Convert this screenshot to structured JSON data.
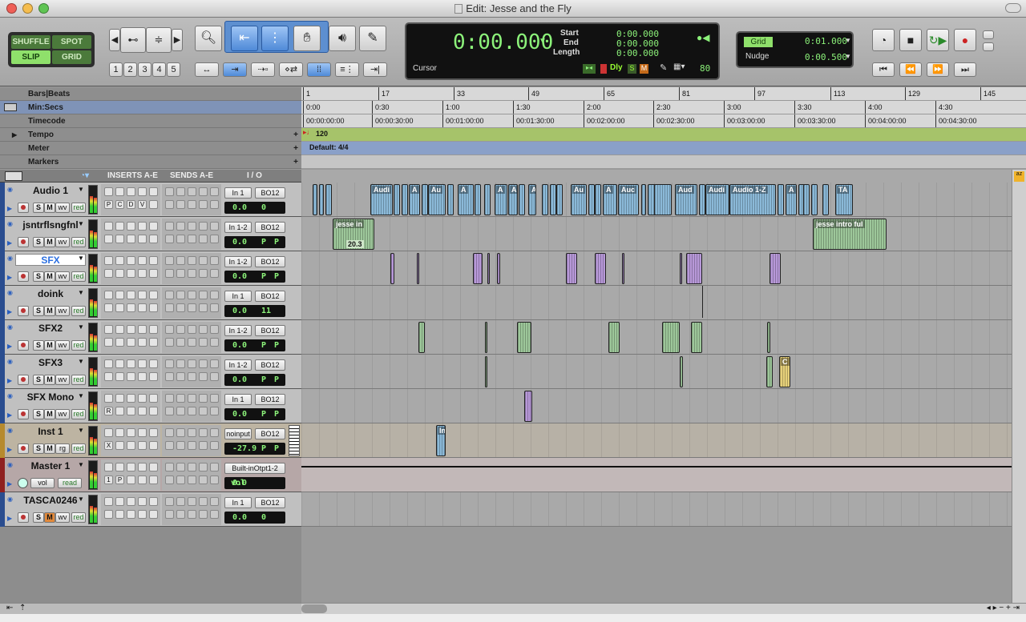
{
  "window": {
    "title": "Edit: Jesse and the Fly"
  },
  "modes": {
    "shuffle": "SHUFFLE",
    "spot": "SPOT",
    "slip": "SLIP",
    "grid": "GRID"
  },
  "zoom_presets": [
    "1",
    "2",
    "3",
    "4",
    "5"
  ],
  "counter": {
    "main": "0:00.000",
    "start_label": "Start",
    "start": "0:00.000",
    "end_label": "End",
    "end": "0:00.000",
    "length_label": "Length",
    "length": "0:00.000",
    "cursor_label": "Cursor",
    "dly": "Dly",
    "s": "S",
    "m": "M",
    "tempo_num": "80"
  },
  "grid": {
    "label": "Grid",
    "value": "0:01.000",
    "nudge_label": "Nudge",
    "nudge_value": "0:00.500"
  },
  "rulers": {
    "bars_label": "Bars|Beats",
    "bars_ticks": [
      "1",
      "17",
      "33",
      "49",
      "65",
      "81",
      "97",
      "113",
      "129",
      "145"
    ],
    "minsecs_label": "Min:Secs",
    "minsecs_ticks": [
      "0:00",
      "0:30",
      "1:00",
      "1:30",
      "2:00",
      "2:30",
      "3:00",
      "3:30",
      "4:00",
      "4:30"
    ],
    "timecode_label": "Timecode",
    "timecode_ticks": [
      "00:00:00:00",
      "00:00:30:00",
      "00:01:00:00",
      "00:01:30:00",
      "00:02:00:00",
      "00:02:30:00",
      "00:03:00:00",
      "00:03:30:00",
      "00:04:00:00",
      "00:04:30:00"
    ],
    "tempo_label": "Tempo",
    "tempo_value": "120",
    "meter_label": "Meter",
    "meter_value": "Default: 4/4",
    "markers_label": "Markers"
  },
  "columns": {
    "inserts": "INSERTS A-E",
    "sends": "SENDS A-E",
    "io": "I / O"
  },
  "tracks": [
    {
      "name": "Audio 1",
      "input": "In 1",
      "output": "BO12",
      "vol": "0.0",
      "pan": "0",
      "mode": "wv",
      "auto": "red",
      "slots": [
        "P",
        "C",
        "D",
        "V"
      ],
      "color": "#2a4d8f"
    },
    {
      "name": "jsntrflsngfnl",
      "input": "In 1-2",
      "output": "BO12",
      "vol": "0.0",
      "pan": "P",
      "pan2": "P",
      "mode": "wv",
      "auto": "red",
      "slots": [],
      "color": "#2a4d8f"
    },
    {
      "name": "SFX",
      "input": "In 1-2",
      "output": "BO12",
      "vol": "0.0",
      "pan": "P",
      "pan2": "P",
      "mode": "wv",
      "auto": "red",
      "slots": [],
      "color": "#2a4d8f"
    },
    {
      "name": "doink",
      "input": "In 1",
      "output": "BO12",
      "vol": "0.0",
      "pan": "11",
      "mode": "wv",
      "auto": "red",
      "slots": [],
      "color": "#2a4d8f"
    },
    {
      "name": "SFX2",
      "input": "In 1-2",
      "output": "BO12",
      "vol": "0.0",
      "pan": "P",
      "pan2": "P",
      "mode": "wv",
      "auto": "red",
      "slots": [],
      "color": "#2a4d8f"
    },
    {
      "name": "SFX3",
      "input": "In 1-2",
      "output": "BO12",
      "vol": "0.0",
      "pan": "P",
      "pan2": "P",
      "mode": "wv",
      "auto": "red",
      "slots": [],
      "color": "#2a4d8f"
    },
    {
      "name": "SFX Mono",
      "input": "In 1",
      "output": "BO12",
      "vol": "0.0",
      "pan": "P",
      "pan2": "P",
      "mode": "wv",
      "auto": "red",
      "slots": [
        "R"
      ],
      "color": "#2a4d8f"
    },
    {
      "name": "Inst 1",
      "input": "noinput",
      "output": "BO12",
      "vol": "-27.9",
      "pan": "P",
      "pan2": "P",
      "mode": "rg",
      "auto": "red",
      "slots": [
        "X"
      ],
      "color": "#b68a2e"
    },
    {
      "name": "Master 1",
      "input": "Built-inOtpt1-2",
      "output": "",
      "vol": "0.0",
      "pan": "vol",
      "mode": "vol",
      "auto": "read",
      "slots": [
        "1",
        "P"
      ],
      "color": "#8f1f1f"
    },
    {
      "name": "TASCA0246",
      "input": "In 1",
      "output": "BO12",
      "vol": "0.0",
      "pan": "0",
      "mode": "wv",
      "auto": "red",
      "slots": [],
      "color": "#2a4d8f"
    }
  ],
  "clips": {
    "audio1": [
      "Audi",
      "A",
      "Au",
      "A",
      "A",
      "A",
      "Ai",
      "Au",
      "A",
      "Auc",
      "Aud",
      "Audi",
      "Audio 1-Z",
      "A",
      "TA"
    ],
    "jsn": [
      "jesse in",
      "20.3",
      "jesse intro ful"
    ],
    "sfx3": [
      "C"
    ],
    "inst": [
      "In"
    ]
  },
  "colors": {
    "audio_clip": "#8bb9d8",
    "green_clip": "#9dc79a",
    "purple_clip": "#b798d8",
    "lcd": "#8cf27a",
    "tempo_bar": "#a6c36a",
    "meter_bar": "#8aa0c8"
  }
}
